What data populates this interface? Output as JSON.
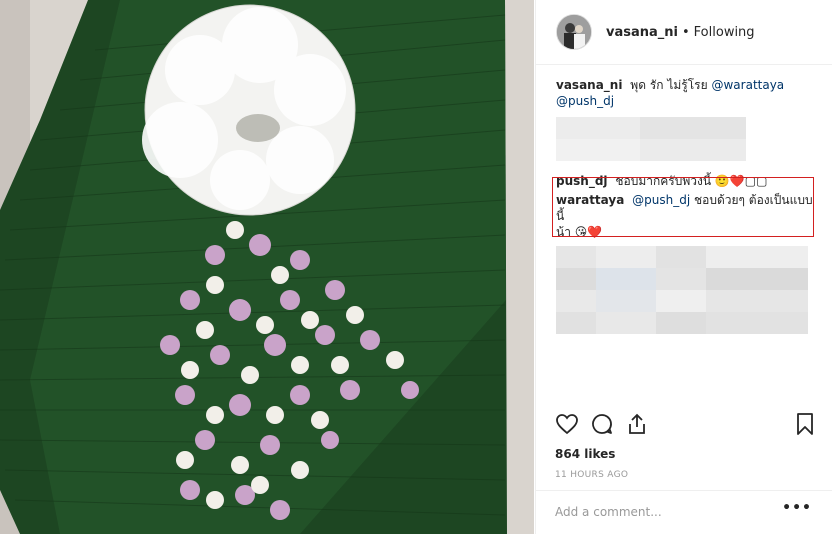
{
  "post": {
    "author": "vasana_ni",
    "separator": "•",
    "follow_status": "Following",
    "caption": {
      "user": "vasana_ni",
      "text": "พุด รัก ไม่รู้โรย",
      "mention1": "@warattaya",
      "mention2": "@push_dj"
    },
    "comments": [
      {
        "user": "push_dj",
        "text": "ชอบมากครับพวงนี้ 🙂❤️▢▢"
      },
      {
        "user": "warattaya",
        "mention": "@push_dj",
        "text": "ชอบด้วยๆ ต้องเป็นแบบนี้",
        "text2": "น้า 😘❤️"
      }
    ],
    "likes": "864 likes",
    "timestamp": "11 HOURS AGO",
    "comment_placeholder": "Add a comment...",
    "more_label": "•••"
  },
  "icons": {
    "like": "heart-icon",
    "comment": "comment-bubble-icon",
    "share": "share-icon",
    "save": "bookmark-icon"
  },
  "colors": {
    "highlight_border": "#d32020",
    "mention": "#003569",
    "leaf": "#1f4a23"
  }
}
